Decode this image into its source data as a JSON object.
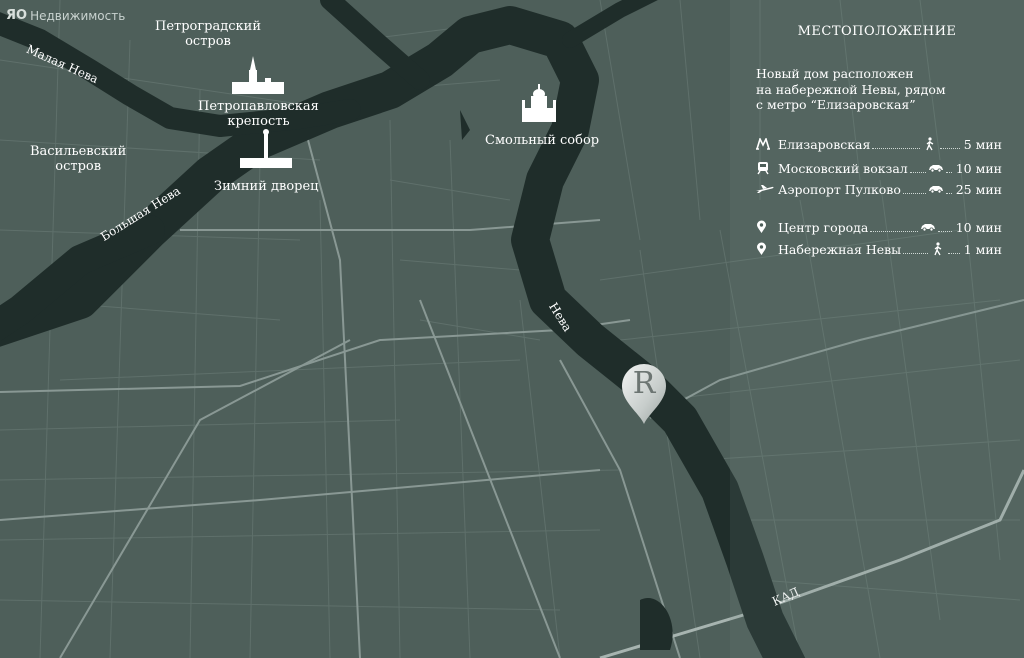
{
  "logo": {
    "mark": "ЯО",
    "text": "Недвижимость"
  },
  "map_labels": {
    "petrogradsky": [
      "Петроградский",
      "остров"
    ],
    "vasilievsky": [
      "Васильевский",
      "остров"
    ],
    "fortress": [
      "Петропавловская",
      "крепость"
    ],
    "winter_palace": "Зимний дворец",
    "smolny": "Смольный собор",
    "malaya_neva": "Малая Нева",
    "bolshaya_neva": "Большая Нева",
    "neva": "Нева",
    "kad": "КАД",
    "marker_letter": "R"
  },
  "panel": {
    "title": "МЕСТОПОЛОЖЕНИЕ",
    "description": [
      "Новый дом расположен",
      "на набережной Невы, рядом",
      "с метро “Елизаровская”"
    ],
    "items": [
      {
        "icon": "metro-icon",
        "name": "Елизаровская",
        "mode": "walk-icon",
        "time": "5 мин"
      },
      {
        "icon": "train-icon",
        "name": "Московский вокзал",
        "mode": "car-icon",
        "time": "10 мин"
      },
      {
        "icon": "plane-icon",
        "name": "Аэропорт Пулково",
        "mode": "car-icon",
        "time": "25 мин"
      },
      {
        "icon": "location-pin-icon",
        "name": "Центр города",
        "mode": "car-icon",
        "time": "10 мин"
      },
      {
        "icon": "location-pin-icon",
        "name": "Набережная Невы",
        "mode": "walk-icon",
        "time": "1 мин"
      }
    ]
  },
  "colors": {
    "land": "#4e5f5a",
    "water": "#1f2d2a",
    "roads": "#6f807b",
    "major_roads": "#8a9995",
    "text": "#ffffff"
  }
}
